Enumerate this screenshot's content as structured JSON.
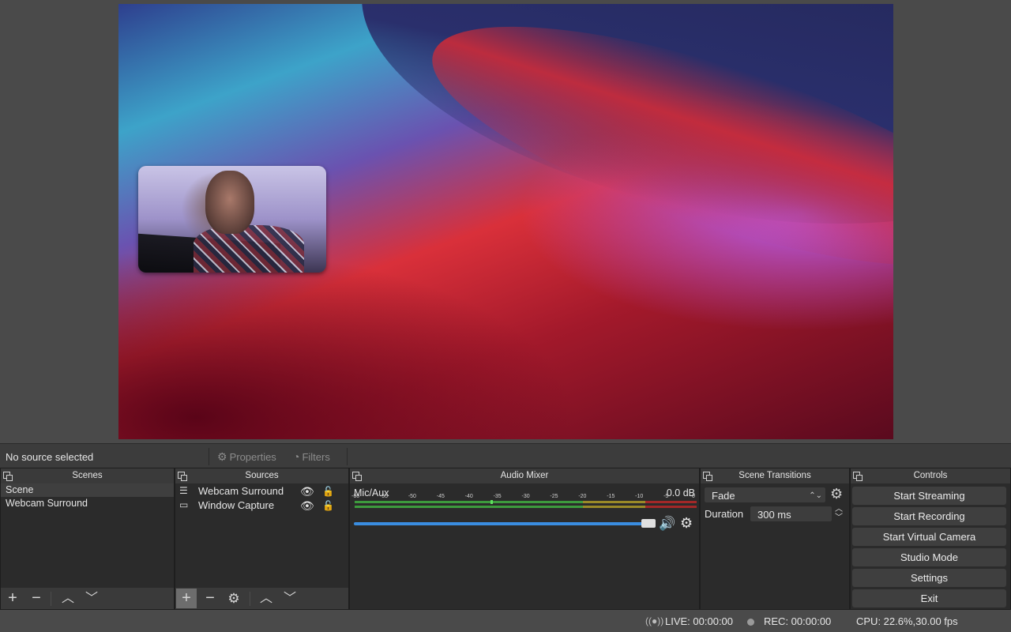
{
  "source_bar": {
    "no_source": "No source selected",
    "properties": "Properties",
    "filters": "Filters"
  },
  "scenes": {
    "title": "Scenes",
    "items": [
      "Scene",
      "Webcam Surround"
    ]
  },
  "sources": {
    "title": "Sources",
    "items": [
      {
        "name": "Webcam Surround",
        "icon": "group-icon"
      },
      {
        "name": "Window Capture",
        "icon": "window-icon"
      }
    ]
  },
  "mixer": {
    "title": "Audio Mixer",
    "channel": "Mic/Aux",
    "db": "0.0 dB",
    "ticks": [
      "-60",
      "-55",
      "-50",
      "-45",
      "-40",
      "-35",
      "-30",
      "-25",
      "-20",
      "-15",
      "-10",
      "-5",
      "0"
    ],
    "volume": 1.0
  },
  "transitions": {
    "title": "Scene Transitions",
    "selected": "Fade",
    "duration_label": "Duration",
    "duration_value": "300 ms"
  },
  "controls": {
    "title": "Controls",
    "buttons": [
      "Start Streaming",
      "Start Recording",
      "Start Virtual Camera",
      "Studio Mode",
      "Settings",
      "Exit"
    ]
  },
  "status": {
    "live": "LIVE: 00:00:00",
    "rec": "REC: 00:00:00",
    "cpu": "CPU: 22.6%,30.00 fps"
  },
  "colors": {
    "meter_green": "#3d9a3d",
    "meter_yellow": "#9a8a28",
    "meter_red": "#a32828",
    "slider_blue": "#3a8de0"
  }
}
